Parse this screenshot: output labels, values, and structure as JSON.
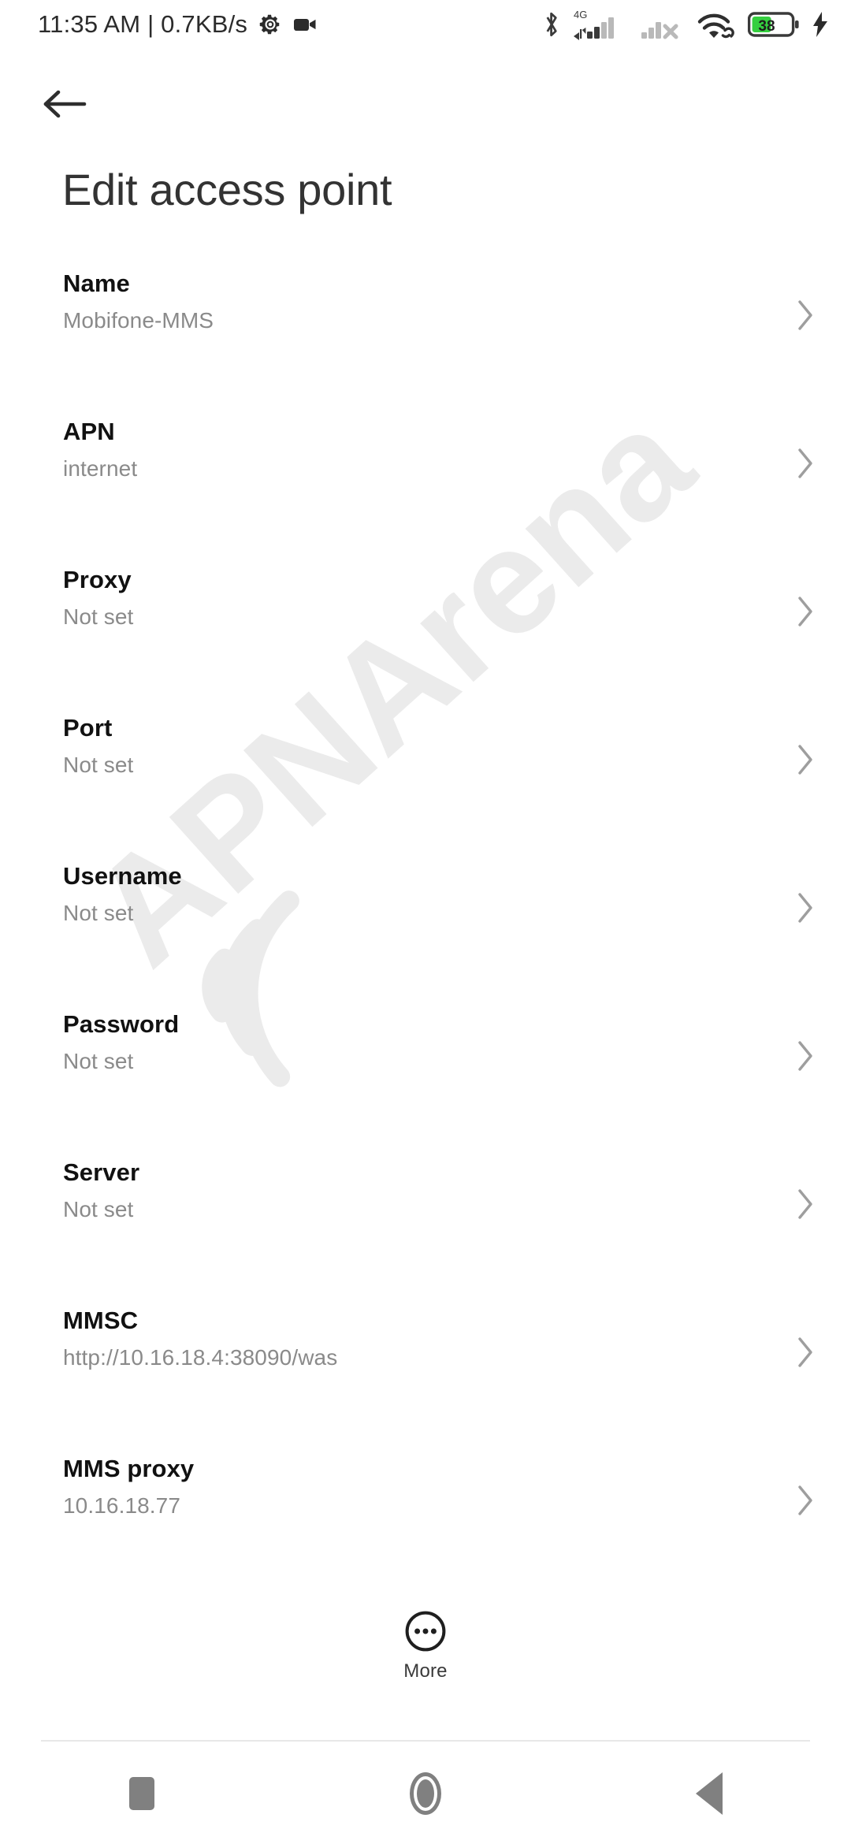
{
  "status_bar": {
    "clock_text": "11:35 AM | 0.7KB/s",
    "icons_left": [
      "gear-icon",
      "video-camera-icon"
    ],
    "icons_right": [
      "bluetooth-icon",
      "signal-4g-icon",
      "signal-sim2-no-service-icon",
      "wifi-link-icon",
      "battery-icon",
      "charging-bolt-icon"
    ],
    "network_label": "4G",
    "battery_percent": "38",
    "battery_fill_color": "#35cf3f",
    "charging": true
  },
  "appbar": {
    "back_icon": "arrow-left-icon"
  },
  "header": {
    "title": "Edit access point"
  },
  "settings": {
    "chevron_icon": "chevron-right-icon",
    "rows": [
      {
        "label": "Name",
        "value": "Mobifone-MMS"
      },
      {
        "label": "APN",
        "value": "internet"
      },
      {
        "label": "Proxy",
        "value": "Not set"
      },
      {
        "label": "Port",
        "value": "Not set"
      },
      {
        "label": "Username",
        "value": "Not set"
      },
      {
        "label": "Password",
        "value": "Not set"
      },
      {
        "label": "Server",
        "value": "Not set"
      },
      {
        "label": "MMSC",
        "value": "http://10.16.18.4:38090/was"
      },
      {
        "label": "MMS proxy",
        "value": "10.16.18.77"
      }
    ]
  },
  "more_button": {
    "label": "More",
    "icon": "more-circle-dots-icon"
  },
  "nav_bar": {
    "recents_label": "recents-square-icon",
    "home_label": "home-circle-icon",
    "back_label": "back-triangle-icon",
    "color": "#808080"
  },
  "watermark": {
    "text": "APNArena",
    "icon": "wifi-arc-icon",
    "color": "#ebebeb"
  }
}
